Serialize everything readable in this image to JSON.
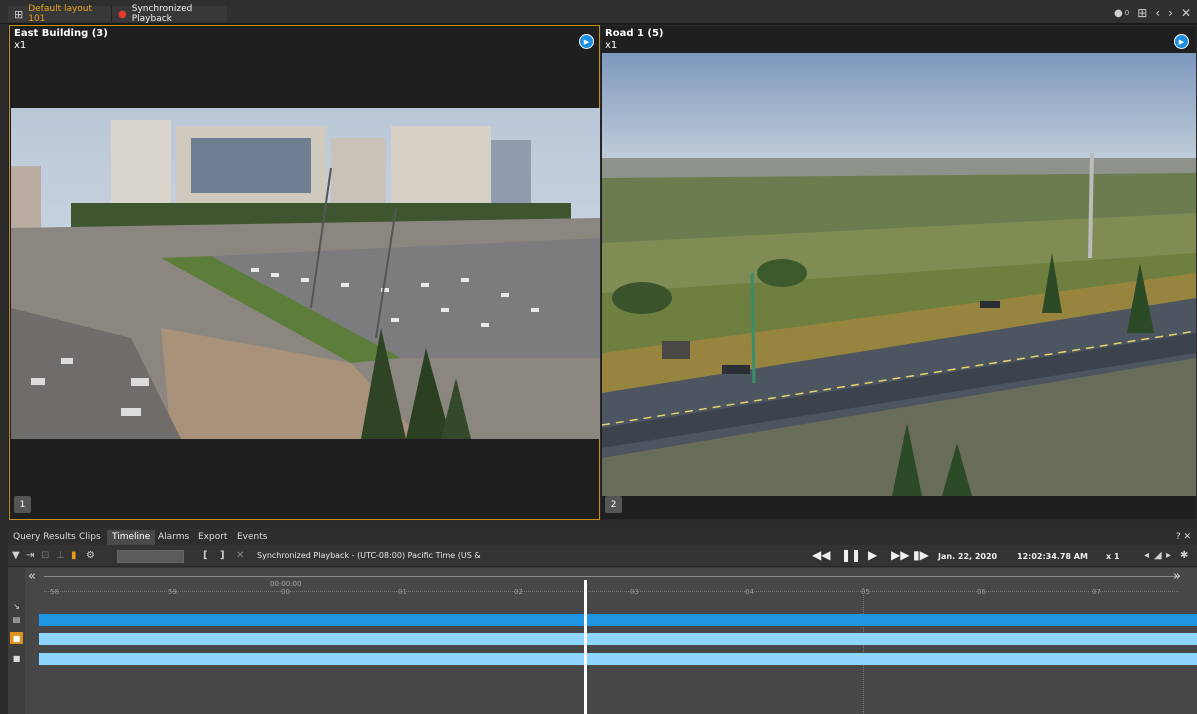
{
  "tabs": [
    {
      "label": "Default layout 101",
      "active": true
    },
    {
      "label": "Synchronized Playback",
      "active": false
    }
  ],
  "top_right_counter": "0",
  "tiles": [
    {
      "title": "East Building (3)",
      "speed": "x1",
      "number": "1",
      "selected": true
    },
    {
      "title": "Road 1 (5)",
      "speed": "x1",
      "number": "2",
      "selected": false
    }
  ],
  "pane_tabs": [
    "Query Results",
    "Clips",
    "Timeline",
    "Alarms",
    "Export",
    "Events"
  ],
  "active_pane_tab": "Timeline",
  "pane_controls": "? ✕",
  "toolbar": {
    "bracket_in": "[",
    "bracket_out": "]",
    "clear_icon": "✕",
    "description": "Synchronized Playback - (UTC-08:00) Pacific Time (US &",
    "date": "Jan. 22, 2020",
    "time": "12:02:34.78 AM",
    "speed": "x 1"
  },
  "timeline": {
    "start_stamp": "00:00:00",
    "ticks": [
      "58",
      "59",
      "00",
      "01",
      "02",
      "03",
      "04",
      "05",
      "06",
      "07"
    ]
  },
  "colors": {
    "accent": "#e8a31c",
    "selected_border": "#c99015",
    "play_button": "#1d8fe0",
    "track_dark": "#1e96e3",
    "track_light": "#8ed6ff"
  }
}
